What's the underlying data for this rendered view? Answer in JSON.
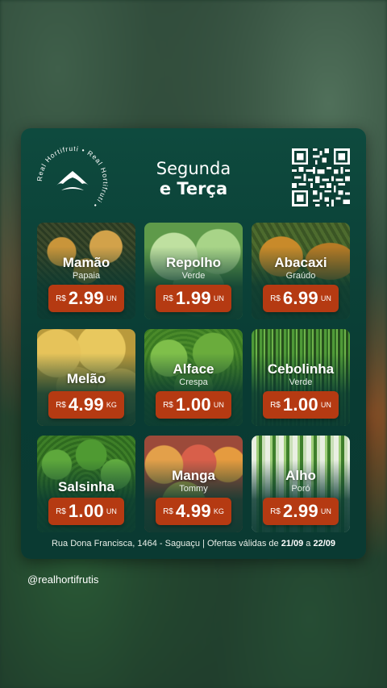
{
  "colors": {
    "card": "#0a3f35",
    "price_tag": "#b53a12",
    "accent_orange": "#c8501c"
  },
  "brand": {
    "ring_text": "Real Hortifruti • Real Hortifruti •",
    "logo_icon": "crown-icon"
  },
  "header": {
    "line1": "Segunda",
    "line2": "e Terça"
  },
  "qr_icon": "qr-code-icon",
  "products": [
    {
      "name": "Mamão",
      "variety": "Papaia",
      "currency": "R$",
      "price": "2.99",
      "unit": "UN"
    },
    {
      "name": "Repolho",
      "variety": "Verde",
      "currency": "R$",
      "price": "1.99",
      "unit": "UN"
    },
    {
      "name": "Abacaxi",
      "variety": "Graúdo",
      "currency": "R$",
      "price": "6.99",
      "unit": "UN"
    },
    {
      "name": "Melão",
      "variety": "",
      "currency": "R$",
      "price": "4.99",
      "unit": "KG"
    },
    {
      "name": "Alface",
      "variety": "Crespa",
      "currency": "R$",
      "price": "1.00",
      "unit": "UN"
    },
    {
      "name": "Cebolinha",
      "variety": "Verde",
      "currency": "R$",
      "price": "1.00",
      "unit": "UN"
    },
    {
      "name": "Salsinha",
      "variety": "",
      "currency": "R$",
      "price": "1.00",
      "unit": "UN"
    },
    {
      "name": "Manga",
      "variety": "Tommy",
      "currency": "R$",
      "price": "4.99",
      "unit": "KG"
    },
    {
      "name": "Alho",
      "variety": "Poró",
      "currency": "R$",
      "price": "2.99",
      "unit": "UN"
    }
  ],
  "footer": {
    "address": "Rua Dona Francisca, 1464 - Saguaçu | Ofertas válidas de ",
    "date_from": "21/09",
    "connector": " a ",
    "date_to": "22/09"
  },
  "handle": "@realhortifrutis"
}
